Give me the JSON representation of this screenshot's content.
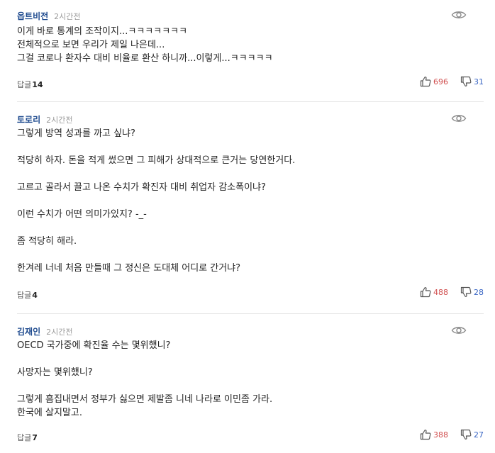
{
  "comments": [
    {
      "author": "옵트비전",
      "time": "2시간전",
      "lines": [
        "이게 바로 통계의 조작이지...ㅋㅋㅋㅋㅋㅋㅋ",
        "전체적으로 보면 우리가 제일 나은데...",
        "그걸 코로나 환자수 대비 비율로 환산 하니까...이렇게...ㅋㅋㅋㅋㅋ"
      ],
      "reply_label": "답글",
      "reply_count": "14",
      "likes": "696",
      "dislikes": "31"
    },
    {
      "author": "토로리",
      "time": "2시간전",
      "lines": [
        "그렇게 방역 성과를 까고 싶냐?",
        "적당히 하자. 돈을 적게 썼으면 그 피해가 상대적으로 큰거는 당연한거다.",
        "고르고 골라서 끌고 나온 수치가 확진자 대비 취업자 감소폭이냐?",
        "이런 수치가 어떤 의미가있지? -_-",
        "좀 적당히 해라.",
        "한겨레 너네 처음 만들때 그 정신은 도대체 어디로 간거냐?"
      ],
      "reply_label": "답글",
      "reply_count": "4",
      "likes": "488",
      "dislikes": "28"
    },
    {
      "author": "김재인",
      "time": "2시간전",
      "lines": [
        "OECD 국가중에 확진율 수는 몇위했니?",
        "사망자는 몇위했니?",
        "그렇게 흠집내면서 정부가 싫으면 제발좀 니네 나라로 이민좀 가라.",
        "한국에 살지말고."
      ],
      "reply_label": "답글",
      "reply_count": "7",
      "likes": "388",
      "dislikes": "27"
    }
  ],
  "icons": {
    "view": "eye-icon",
    "like": "thumbs-up-icon",
    "dislike": "thumbs-down-icon"
  },
  "colors": {
    "author": "#1f4b8f",
    "like_count": "#d04d4d",
    "dislike_count": "#3a66c4",
    "divider": "#e5e5e5"
  }
}
